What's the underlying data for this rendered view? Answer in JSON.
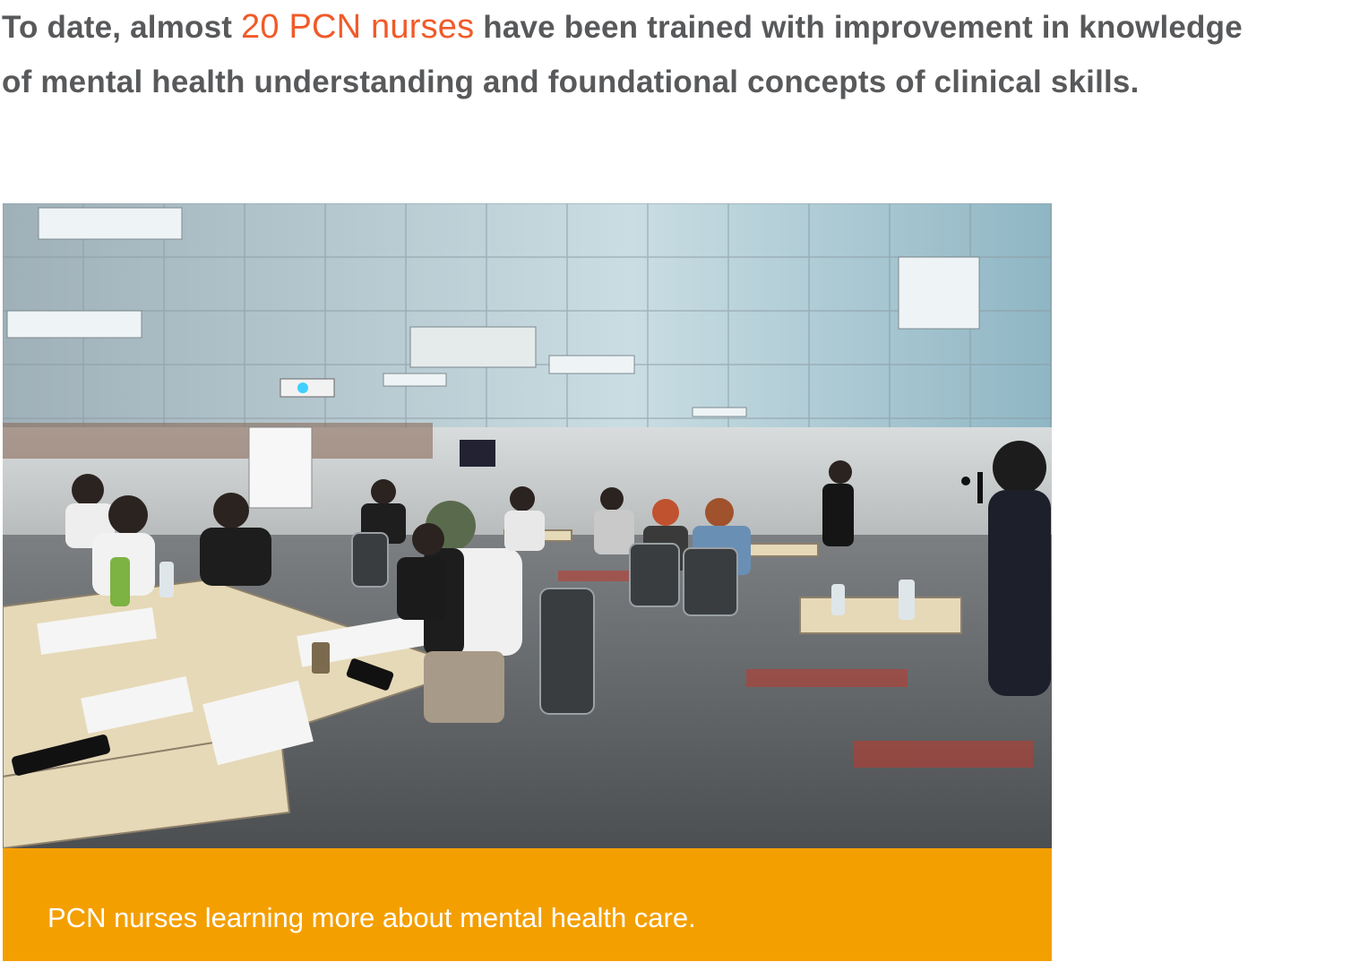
{
  "intro": {
    "before": "To date, almost ",
    "highlight": "20 PCN nurses",
    "after": " have been trained with improvement in knowledge of mental health understanding and foundational concepts of clinical skills."
  },
  "photo": {
    "description_icon": "classroom-training-photo"
  },
  "caption": {
    "text": "PCN nurses learning more about mental health care."
  },
  "colors": {
    "text": "#58595b",
    "highlight": "#f15a29",
    "caption_bg": "#f49f00",
    "caption_text": "#ffffff"
  }
}
